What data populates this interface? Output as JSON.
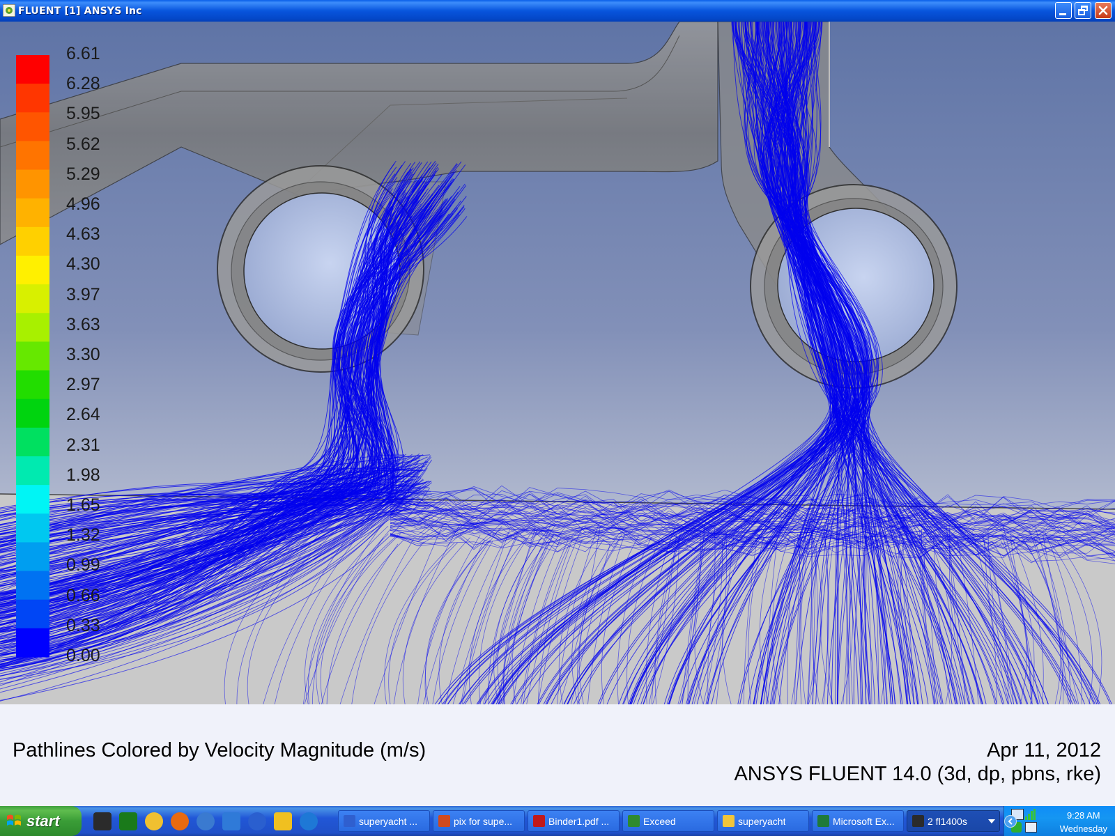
{
  "window": {
    "title": "FLUENT [1] ANSYS Inc",
    "buttons": [
      "minimize",
      "restore",
      "close"
    ]
  },
  "legend": {
    "labels": [
      "6.61",
      "6.28",
      "5.95",
      "5.62",
      "5.29",
      "4.96",
      "4.63",
      "4.30",
      "3.97",
      "3.63",
      "3.30",
      "2.97",
      "2.64",
      "2.31",
      "1.98",
      "1.65",
      "1.32",
      "0.99",
      "0.66",
      "0.33",
      "0.00"
    ],
    "colors": [
      "#ff0000",
      "#ff3600",
      "#ff5500",
      "#ff7400",
      "#ff9400",
      "#ffb200",
      "#ffd000",
      "#fff000",
      "#d8f000",
      "#a8f000",
      "#66e800",
      "#22dd00",
      "#00d40f",
      "#00e060",
      "#00eab0",
      "#00f5f5",
      "#00c8f0",
      "#009ef0",
      "#0072f2",
      "#0046f5",
      "#0000ff"
    ]
  },
  "scene": {
    "background_top": "#5f74a6",
    "background_bottom": "#d4d7df",
    "floor_color": "#c8c8c8",
    "pipe_color": "#8a8a8a",
    "pathline_color": "#0000ee"
  },
  "info": {
    "caption": "Pathlines Colored by Velocity Magnitude (m/s)",
    "date": "Apr 11, 2012",
    "version": "ANSYS FLUENT 14.0 (3d, dp, pbns, rke)"
  },
  "taskbar": {
    "start_label": "start",
    "quick_launch": [
      "exceed-icon",
      "gnome-icon",
      "folder-icon",
      "firefox-icon",
      "mail-icon",
      "update-icon",
      "media-player-icon",
      "acrobat-icon",
      "internet-explorer-icon"
    ],
    "tasks": [
      {
        "label": "superyacht ...",
        "icon": "word-icon",
        "color": "#2f5fcf"
      },
      {
        "label": "pix for supe...",
        "icon": "powerpoint-icon",
        "color": "#d04a1f"
      },
      {
        "label": "Binder1.pdf ...",
        "icon": "pdf-icon",
        "color": "#c0191a"
      },
      {
        "label": "Exceed",
        "icon": "exceed-icon",
        "color": "#2f8a2f"
      },
      {
        "label": "superyacht",
        "icon": "folder-icon",
        "color": "#f2c53a"
      },
      {
        "label": "Microsoft Ex...",
        "icon": "excel-icon",
        "color": "#1f7a3a"
      },
      {
        "label": "2 fl1400s",
        "icon": "fluent-icon",
        "color": "#2b2b2b"
      }
    ],
    "clock_time": "9:28 AM",
    "clock_day": "Wednesday"
  }
}
